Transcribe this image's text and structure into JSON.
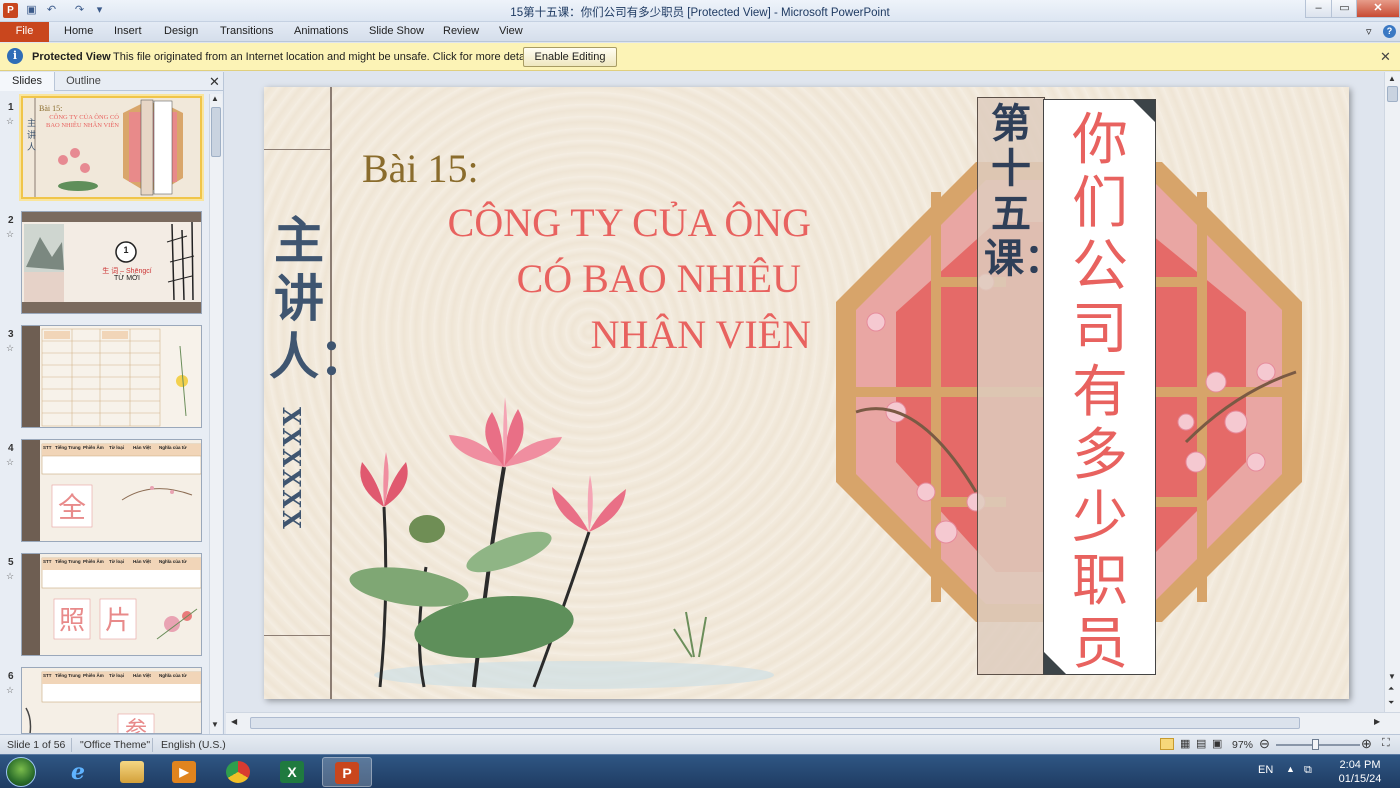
{
  "window": {
    "title": "15第十五课：你们公司有多少职员 [Protected View] - Microsoft PowerPoint",
    "app_icon": "P"
  },
  "ribbon": {
    "file": "File",
    "tabs": [
      "Home",
      "Insert",
      "Design",
      "Transitions",
      "Animations",
      "Slide Show",
      "Review",
      "View"
    ]
  },
  "protected_view": {
    "title": "Protected View",
    "message": "This file originated from an Internet location and might be unsafe. Click for more details.",
    "button": "Enable Editing"
  },
  "pane": {
    "tabs": [
      "Slides",
      "Outline"
    ],
    "thumbnails": [
      {
        "num": "1",
        "caption_a": "Bài 15:",
        "caption_b": "CÔNG TY CỦA ÔNG CÓ BAO NHIÊU NHÂN VIÊN"
      },
      {
        "num": "2",
        "caption_a": "1",
        "caption_b": "生 词 – Shēngcí",
        "caption_c": "TỪ MỚI"
      },
      {
        "num": "3"
      },
      {
        "num": "4",
        "headers": [
          "STT",
          "Tiếng Trung",
          "Phiên Âm",
          "Từ loại",
          "Hán Việt",
          "Nghĩa của từ"
        ],
        "big_char": "全"
      },
      {
        "num": "5",
        "headers": [
          "STT",
          "Tiếng Trung",
          "Phiên Âm",
          "Từ loại",
          "Hán Việt",
          "Nghĩa của từ"
        ],
        "big_chars": [
          "照",
          "片"
        ]
      },
      {
        "num": "6",
        "headers": [
          "STT",
          "Tiếng Trung",
          "Phiên Âm",
          "Từ loại",
          "Hán Việt",
          "Nghĩa của từ"
        ],
        "big_char": "参"
      }
    ]
  },
  "slide": {
    "presenter": "主讲人：",
    "presenter_name": "XXXXXX",
    "lesson": "Bài 15:",
    "title_lines": [
      "CÔNG TY CỦA ÔNG",
      "CÓ BAO NHIÊU",
      "NHÂN VIÊN"
    ],
    "lesson_cn": "第十五课：",
    "title_cn": "你们公司有多少职员"
  },
  "status": {
    "slide_info": "Slide 1 of 56",
    "theme": "\"Office Theme\"",
    "language": "English (U.S.)",
    "zoom": "97%"
  },
  "taskbar": {
    "lang": "EN",
    "time": "2:04 PM",
    "date": "01/15/24"
  },
  "colors": {
    "file_tab": "#c9461d",
    "protected_bar": "#fcf3b6",
    "title_red": "#e8625f",
    "lesson_gold": "#8a6c2c",
    "ink_blue": "#3f5570"
  }
}
